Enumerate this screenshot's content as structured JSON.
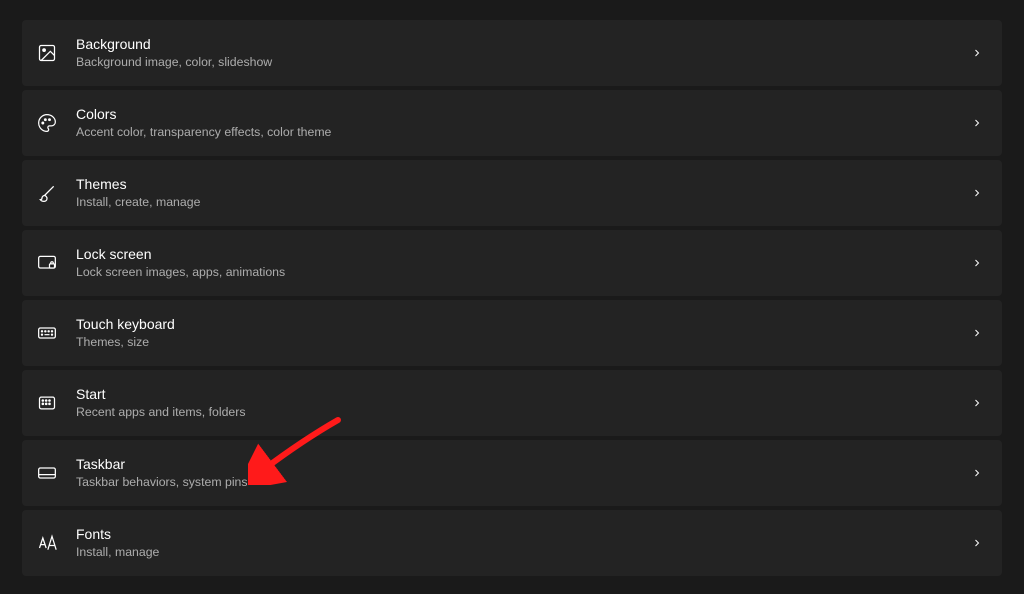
{
  "settings": {
    "items": [
      {
        "id": "background",
        "title": "Background",
        "subtitle": "Background image, color, slideshow",
        "icon": "image"
      },
      {
        "id": "colors",
        "title": "Colors",
        "subtitle": "Accent color, transparency effects, color theme",
        "icon": "palette"
      },
      {
        "id": "themes",
        "title": "Themes",
        "subtitle": "Install, create, manage",
        "icon": "brush"
      },
      {
        "id": "lockscreen",
        "title": "Lock screen",
        "subtitle": "Lock screen images, apps, animations",
        "icon": "lock-screen"
      },
      {
        "id": "touchkeyboard",
        "title": "Touch keyboard",
        "subtitle": "Themes, size",
        "icon": "keyboard"
      },
      {
        "id": "start",
        "title": "Start",
        "subtitle": "Recent apps and items, folders",
        "icon": "start-grid"
      },
      {
        "id": "taskbar",
        "title": "Taskbar",
        "subtitle": "Taskbar behaviors, system pins",
        "icon": "taskbar"
      },
      {
        "id": "fonts",
        "title": "Fonts",
        "subtitle": "Install, manage",
        "icon": "fonts"
      }
    ]
  },
  "annotation": {
    "type": "arrow",
    "color": "#ff1a1a",
    "target": "taskbar"
  }
}
